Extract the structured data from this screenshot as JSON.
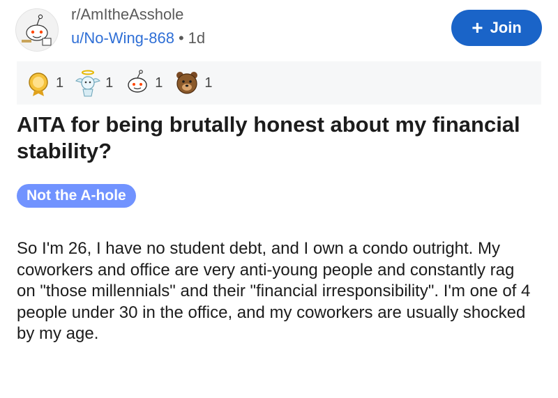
{
  "post": {
    "subreddit": "r/AmItheAsshole",
    "author": "u/No-Wing-868",
    "separator": "•",
    "age": "1d",
    "join_label": "Join",
    "awards": [
      {
        "icon": "gold-award-icon",
        "count": "1"
      },
      {
        "icon": "angel-award-icon",
        "count": "1"
      },
      {
        "icon": "snoo-award-icon",
        "count": "1"
      },
      {
        "icon": "bear-award-icon",
        "count": "1"
      }
    ],
    "title": "AITA for being brutally honest about my financial stability?",
    "flair": "Not the A-hole",
    "body": "So I'm 26, I have no student debt, and I own a condo outright. My coworkers and office are very anti-young people and constantly rag on \"those millennials\" and their \"financial irresponsibility\". I'm one of 4 people under 30 in the office, and my coworkers are usually shocked by my age."
  },
  "colors": {
    "join_button": "#1a64c8",
    "author_link": "#2f6fd6",
    "flair_background": "#7193ff",
    "award_bar_background": "#f6f7f8"
  }
}
